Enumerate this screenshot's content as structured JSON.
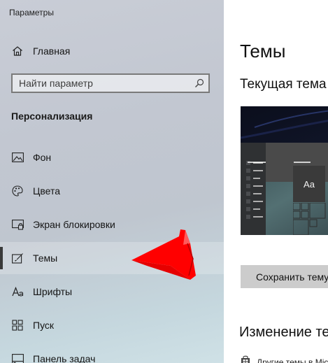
{
  "window": {
    "title": "Параметры"
  },
  "home": {
    "label": "Главная",
    "icon": "home-icon"
  },
  "search": {
    "placeholder": "Найти параметр",
    "icon": "search-icon"
  },
  "section": {
    "title": "Персонализация"
  },
  "nav": [
    {
      "label": "Фон",
      "icon": "picture-icon",
      "selected": false
    },
    {
      "label": "Цвета",
      "icon": "palette-icon",
      "selected": false
    },
    {
      "label": "Экран блокировки",
      "icon": "lock-screen-icon",
      "selected": false
    },
    {
      "label": "Темы",
      "icon": "brush-icon",
      "selected": true
    },
    {
      "label": "Шрифты",
      "icon": "font-icon",
      "selected": false
    },
    {
      "label": "Пуск",
      "icon": "start-icon",
      "selected": false
    },
    {
      "label": "Панель задач",
      "icon": "taskbar-icon",
      "selected": false
    }
  ],
  "main": {
    "title": "Темы",
    "current_theme": "Текущая тема",
    "preview_text": "Aa",
    "save_button": "Сохранить тему",
    "change_title": "Изменение темы",
    "other_themes": "Другие темы в Microsoft Store"
  },
  "colors": {
    "accent": "#3a3a3a",
    "annotation_arrow": "#ff0000"
  }
}
